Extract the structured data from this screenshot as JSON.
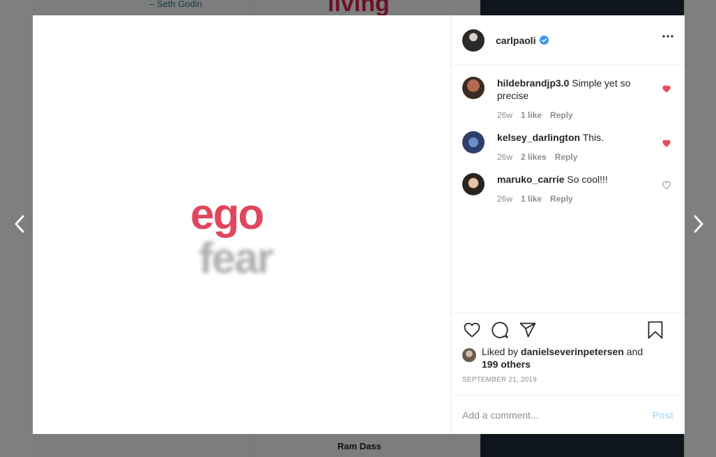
{
  "background": {
    "author_text": "– Seth Godin",
    "word_text": "living",
    "bottom_text": "Ram Dass"
  },
  "media": {
    "word_top": "ego",
    "word_bottom": "fear"
  },
  "header": {
    "username": "carlpaoli",
    "verified_icon": "verified-badge-icon",
    "more_icon": "more-options-icon"
  },
  "comments": [
    {
      "user": "hildebrandjp3.0",
      "text": "Simple yet so precise",
      "age": "26w",
      "likes": "1 like",
      "reply": "Reply",
      "liked": true
    },
    {
      "user": "kelsey_darlington",
      "text": "This.",
      "age": "26w",
      "likes": "2 likes",
      "reply": "Reply",
      "liked": true
    },
    {
      "user": "maruko_carrie",
      "text": "So cool!!!",
      "age": "26w",
      "likes": "1 like",
      "reply": "Reply",
      "liked": false
    }
  ],
  "actions": {
    "liked_by_prefix": "Liked by",
    "liked_by_user": "danielseverinpetersen",
    "liked_by_and": "and",
    "others": "199 others",
    "date": "SEPTEMBER 21, 2019"
  },
  "add_comment": {
    "placeholder": "Add a comment...",
    "post_label": "Post"
  },
  "colors": {
    "heart_liked": "#ed4956",
    "verified": "#3897f0",
    "post_disabled": "#b2dffc",
    "accent_red": "#e0475f"
  }
}
